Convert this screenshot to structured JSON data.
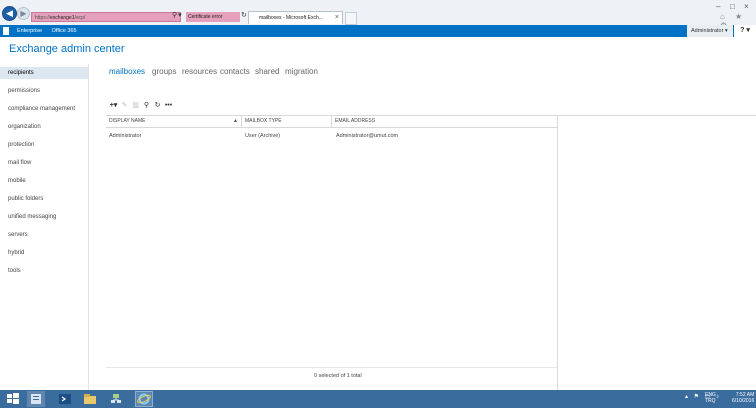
{
  "browser": {
    "back_icon": "back-arrow-icon",
    "forward_icon": "forward-arrow-icon",
    "address_prefix": "https://",
    "address_host": "exchange1",
    "address_suffix": "/ecp/",
    "certificate_error": "Certificate error",
    "tab_title": "mailboxes - Microsoft Exch...",
    "right_icons": "⌂ ★ ⚙"
  },
  "topbar": {
    "links": [
      "Enterprise",
      "Office 365"
    ],
    "user": "Administrator ▾",
    "help": "? ▾"
  },
  "app_title": "Exchange admin center",
  "nav": {
    "active_index": 0,
    "items": [
      "recipients",
      "permissions",
      "compliance management",
      "organization",
      "protection",
      "mail flow",
      "mobile",
      "public folders",
      "unified messaging",
      "servers",
      "hybrid",
      "tools"
    ]
  },
  "subtabs": {
    "active_index": 0,
    "items": [
      "mailboxes",
      "groups",
      "resources",
      "contacts",
      "shared",
      "migration"
    ]
  },
  "toolbar": {
    "icons": [
      "add-icon",
      "edit-icon",
      "delete-icon",
      "search-icon",
      "refresh-icon",
      "more-icon"
    ]
  },
  "grid": {
    "columns": [
      "DISPLAY NAME",
      "MAILBOX TYPE",
      "EMAIL ADDRESS"
    ],
    "sort_indicator": "▲",
    "rows": [
      {
        "display_name": "Administrator",
        "mailbox_type": "User (Archive)",
        "email": "Administrator@umut.com"
      }
    ],
    "status": "0 selected of 1 total"
  },
  "taskbar": {
    "tray_lang": "ENG",
    "tray_region": "TRQ",
    "time": "7:52 AM",
    "date": "6/10/2016"
  },
  "colors": {
    "accent": "#0072c6",
    "taskbar": "#3b6c9e",
    "address_error": "#e5a0bb"
  }
}
